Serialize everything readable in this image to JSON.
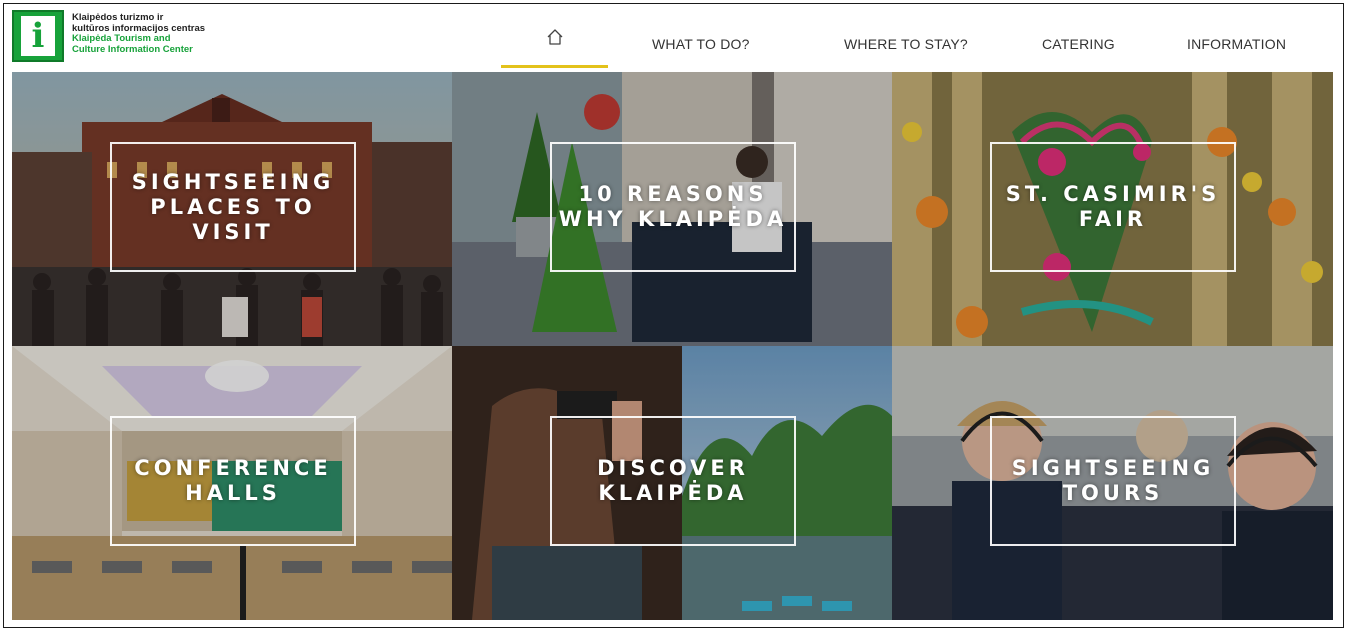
{
  "logo": {
    "lt_line1": "Klaipėdos turizmo ir",
    "lt_line2": "kultūros informacijos centras",
    "en_line1": "Klaipėda Tourism and",
    "en_line2": "Culture Information Center",
    "icon": "info-i-icon",
    "brand_color": "#17a23a"
  },
  "nav": {
    "home_icon": "home-icon",
    "items": [
      {
        "label": "WHAT TO DO?"
      },
      {
        "label": "WHERE TO STAY?"
      },
      {
        "label": "CATERING"
      },
      {
        "label": "INFORMATION"
      }
    ],
    "active_underline_color": "#e3c21b"
  },
  "tiles": [
    {
      "title": "SIGHTSEEING PLACES TO VISIT"
    },
    {
      "title": "10 REASONS WHY KLAIPĖDA"
    },
    {
      "title": "ST. CASIMIR'S FAIR"
    },
    {
      "title": "CONFERENCE HALLS"
    },
    {
      "title": "DISCOVER KLAIPĖDA"
    },
    {
      "title": "SIGHTSEEING TOURS"
    }
  ]
}
